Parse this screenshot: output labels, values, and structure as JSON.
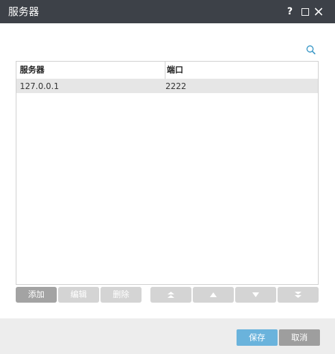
{
  "window": {
    "title": "服务器",
    "help_label": "?"
  },
  "table": {
    "columns": [
      "服务器",
      "端口"
    ],
    "rows": [
      {
        "server": "127.0.0.1",
        "port": "2222"
      }
    ]
  },
  "toolbar": {
    "add_label": "添加",
    "edit_label": "编辑",
    "delete_label": "删除"
  },
  "footer": {
    "save_label": "保存",
    "cancel_label": "取消"
  },
  "colors": {
    "titlebar": "#3d4148",
    "save": "#6ab3dc",
    "cancel": "#9e9e9e",
    "search_icon": "#3a98c7"
  }
}
